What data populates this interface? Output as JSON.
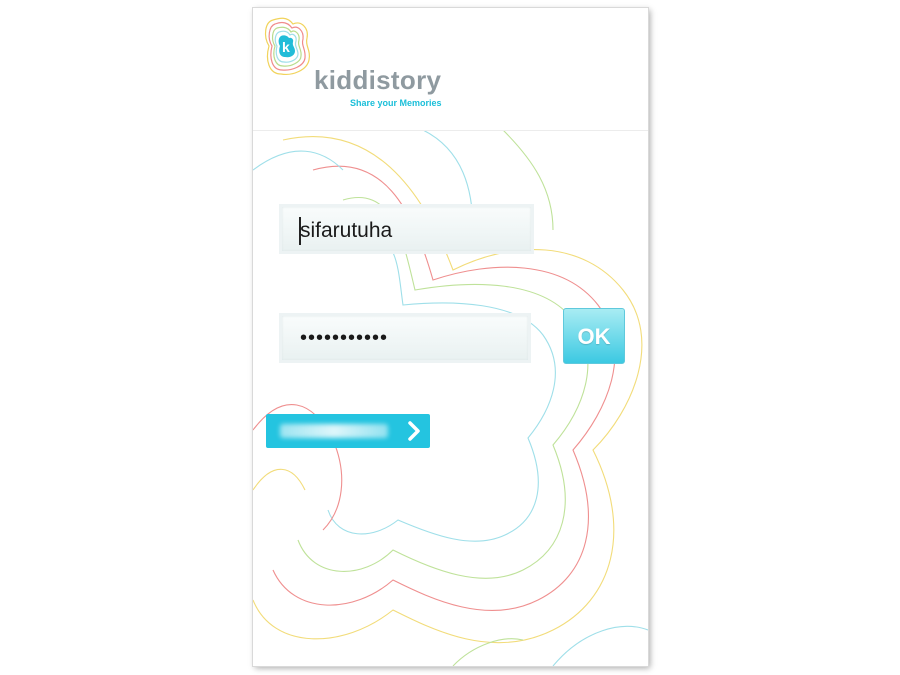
{
  "app": {
    "brand_name": "kiddistory",
    "tagline": "Share your Memories"
  },
  "login": {
    "username_value": "sifarutuha",
    "password_value": "•••••••••••",
    "ok_label": "OK",
    "action_button_label": ""
  },
  "icons": {
    "logo": "kiddistory-logo-icon",
    "action_arrow": "chevron-right-icon"
  },
  "colors": {
    "accent": "#24c4e0",
    "brand_gray": "#8f9aa0",
    "tagline": "#1bbfd9"
  }
}
